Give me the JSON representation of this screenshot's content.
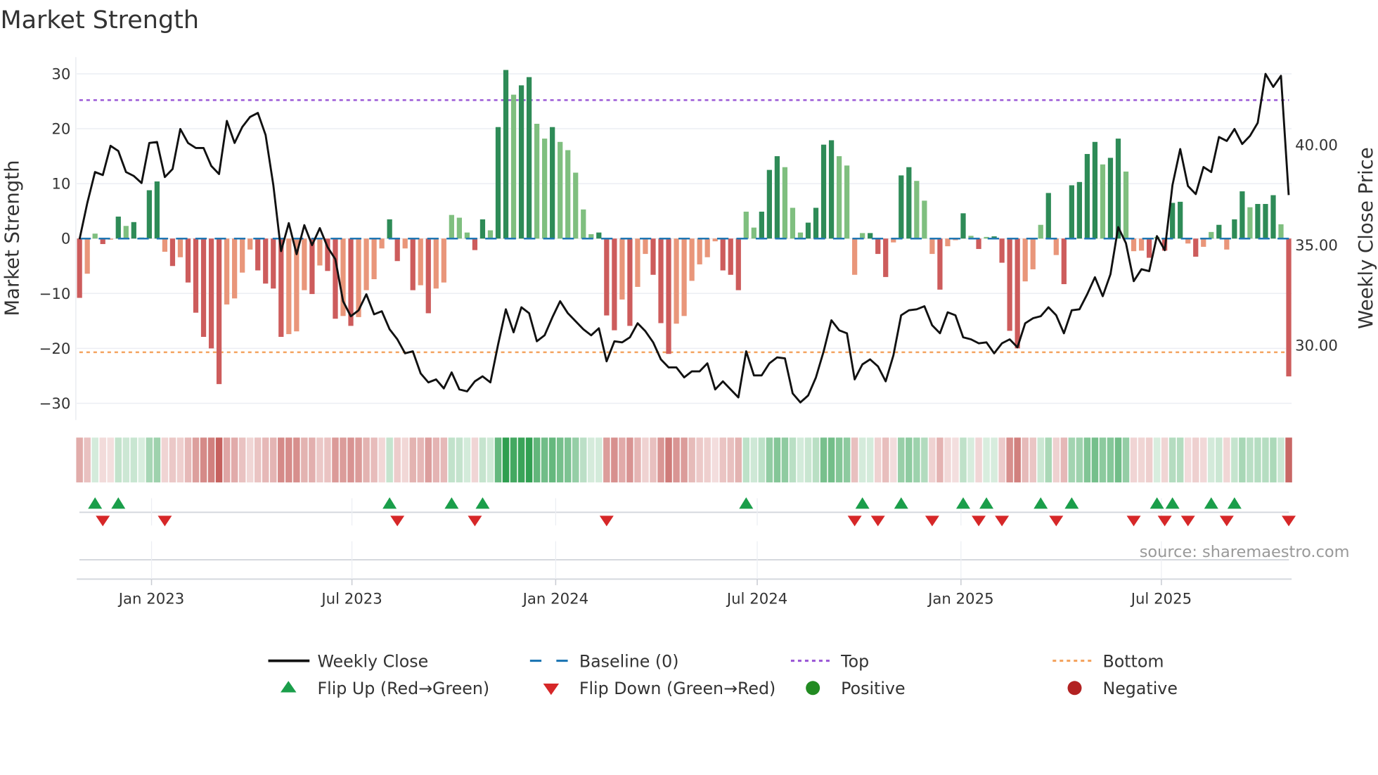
{
  "chart_data": {
    "type": "bar+line",
    "title": "Market Strength",
    "ylabel": "Market Strength",
    "y2label": "Weekly Close Price",
    "source": "source: sharemaestro.com",
    "frequency": "weekly",
    "start_date": "2022-10-28",
    "ylim": [
      -30,
      30
    ],
    "y_ticks": [
      30,
      20,
      10,
      0,
      -10,
      -20,
      -30
    ],
    "y_tick_labels": [
      "30",
      "20",
      "10",
      "0",
      "−10",
      "−20",
      "−30"
    ],
    "y2_ticks": [
      40,
      35,
      30
    ],
    "y2_tick_labels": [
      "40.00",
      "35.00",
      "30.00"
    ],
    "x_ticks": [
      "2023-01-01",
      "2023-07-01",
      "2024-01-01",
      "2024-07-01",
      "2025-01-01",
      "2025-07-01"
    ],
    "x_tick_labels": [
      "Jan 2023",
      "Jul 2023",
      "Jan 2024",
      "Jul 2024",
      "Jan 2025",
      "Jul 2025"
    ],
    "top_level": 25.2,
    "bottom_level": -20.7,
    "baseline": 0,
    "strength": [
      -10.8,
      -6.4,
      0.9,
      -1.0,
      -0.2,
      4.0,
      2.3,
      3.0,
      0.2,
      8.8,
      10.4,
      -2.4,
      -5.0,
      -3.4,
      -8.0,
      -13.5,
      -17.9,
      -20.0,
      -26.5,
      -12.0,
      -10.9,
      -6.2,
      -2.0,
      -5.8,
      -8.2,
      -9.1,
      -17.9,
      -17.4,
      -16.9,
      -9.4,
      -10.1,
      -4.9,
      -5.9,
      -14.6,
      -14.1,
      -15.9,
      -14.3,
      -9.4,
      -7.4,
      -1.8,
      3.5,
      -4.1,
      -1.8,
      -9.4,
      -8.5,
      -13.6,
      -9.1,
      -8.0,
      4.3,
      3.8,
      1.1,
      -2.1,
      3.5,
      1.5,
      20.3,
      30.7,
      26.2,
      27.9,
      29.4,
      20.9,
      18.2,
      20.3,
      17.6,
      16.1,
      12.0,
      5.3,
      0.8,
      1.1,
      -14.0,
      -16.7,
      -11.1,
      -15.9,
      -8.8,
      -2.8,
      -6.6,
      -15.4,
      -21.0,
      -15.5,
      -14.1,
      -7.7,
      -4.7,
      -3.4,
      -0.5,
      -5.8,
      -6.6,
      -9.4,
      4.9,
      2.0,
      4.9,
      12.5,
      15.0,
      13.0,
      5.6,
      1.1,
      2.9,
      5.6,
      17.1,
      17.9,
      15.0,
      13.3,
      -6.6,
      1.0,
      1.0,
      -2.8,
      -7.0,
      -0.7,
      11.5,
      13.0,
      10.5,
      6.9,
      -2.8,
      -9.3,
      -1.4,
      -0.3,
      4.6,
      0.5,
      -1.9,
      0.3,
      0.4,
      -4.4,
      -16.8,
      -20.0,
      -7.8,
      -5.6,
      2.5,
      8.3,
      -3.0,
      -8.3,
      9.7,
      10.3,
      15.4,
      17.6,
      13.5,
      14.7,
      18.2,
      12.2,
      -2.3,
      -2.2,
      -3.5,
      0.3,
      -2.2,
      6.5,
      6.7,
      -0.9,
      -3.3,
      -1.5,
      1.2,
      2.5,
      -2.0,
      3.5,
      8.6,
      5.7,
      6.3,
      6.3,
      7.9,
      2.6,
      -25.1
    ],
    "weekly_close": [
      35.3,
      37.1,
      38.65,
      38.5,
      39.96,
      39.7,
      38.65,
      38.45,
      38.1,
      40.1,
      40.15,
      38.4,
      38.8,
      40.8,
      40.1,
      39.85,
      39.85,
      38.95,
      38.55,
      41.2,
      40.1,
      40.9,
      41.4,
      41.6,
      40.5,
      38.0,
      34.7,
      36.1,
      34.55,
      36.0,
      35.0,
      35.85,
      34.9,
      34.3,
      32.2,
      31.45,
      31.75,
      32.55,
      31.55,
      31.7,
      30.8,
      30.3,
      29.6,
      29.7,
      28.6,
      28.15,
      28.3,
      27.85,
      28.65,
      27.8,
      27.7,
      28.2,
      28.45,
      28.15,
      30.05,
      31.8,
      30.65,
      31.9,
      31.6,
      30.2,
      30.5,
      31.4,
      32.2,
      31.6,
      31.2,
      30.8,
      30.5,
      30.85,
      29.2,
      30.2,
      30.15,
      30.4,
      31.1,
      30.7,
      30.15,
      29.3,
      28.9,
      28.9,
      28.4,
      28.7,
      28.7,
      29.1,
      27.8,
      28.2,
      27.8,
      27.4,
      29.7,
      28.5,
      28.5,
      29.1,
      29.4,
      29.35,
      27.6,
      27.15,
      27.5,
      28.4,
      29.7,
      31.25,
      30.75,
      30.6,
      28.3,
      29.05,
      29.3,
      28.95,
      28.2,
      29.5,
      31.5,
      31.75,
      31.8,
      31.95,
      31.0,
      30.6,
      31.65,
      31.5,
      30.4,
      30.3,
      30.1,
      30.15,
      29.6,
      30.1,
      30.3,
      29.9,
      31.1,
      31.35,
      31.45,
      31.9,
      31.5,
      30.6,
      31.75,
      31.8,
      32.55,
      33.4,
      32.45,
      33.55,
      35.9,
      35.1,
      33.2,
      33.8,
      33.7,
      35.45,
      34.75,
      38.0,
      39.8,
      37.95,
      37.55,
      38.9,
      38.65,
      40.4,
      40.2,
      40.8,
      40.05,
      40.45,
      41.1,
      43.55,
      42.9,
      43.45,
      37.5
    ],
    "flip_up_weeks": [
      2,
      5,
      40,
      48,
      52,
      86,
      101,
      106,
      114,
      117,
      124,
      128,
      139,
      141,
      146,
      149
    ],
    "flip_down_weeks": [
      3,
      11,
      41,
      51,
      68,
      100,
      103,
      110,
      116,
      119,
      126,
      136,
      140,
      143,
      148,
      156
    ],
    "legend": {
      "weekly_close": "Weekly Close",
      "baseline": "Baseline (0)",
      "top": "Top",
      "bottom": "Bottom",
      "flip_up": "Flip Up (Red→Green)",
      "flip_down": "Flip Down (Green→Red)",
      "positive": "Positive",
      "negative": "Negative"
    },
    "legend_placement": "bottom",
    "grid": true
  },
  "colors": {
    "pos_strong": "#2e8b57",
    "pos_weak": "#7fbf7f",
    "neg_strong": "#cd5c5c",
    "neg_weak": "#e9967a",
    "baseline": "#1f77b4",
    "top": "#9b59d6",
    "bottom": "#f4a460",
    "close": "#111111",
    "flip_up": "#1a9e4a",
    "flip_down": "#d62728",
    "positive": "#228b22",
    "negative": "#b22222"
  }
}
